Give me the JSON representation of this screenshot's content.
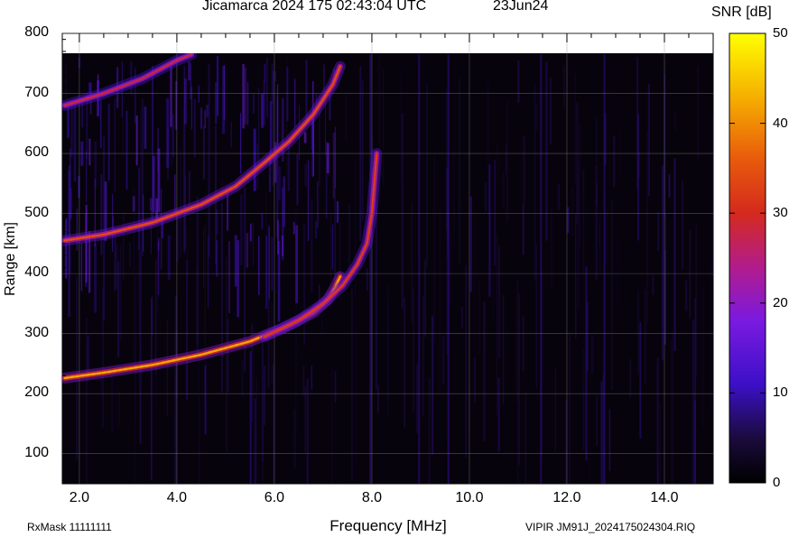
{
  "header": {
    "title": "Jicamarca 2024 175 02:43:04 UTC",
    "date": "23Jun24"
  },
  "footer": {
    "rxmask": "RxMask 11111111",
    "file": "VIPIR  JM91J_2024175024304.RIQ"
  },
  "chart_data": {
    "type": "heatmap",
    "title": "Jicamarca 2024 175 02:43:04 UTC",
    "xlabel": "Frequency [MHz]",
    "ylabel": "Range [km]",
    "xlim": [
      1.65,
      15.0
    ],
    "ylim": [
      50,
      800
    ],
    "data_top_range_km": 765,
    "x_ticks": [
      "2.0",
      "4.0",
      "6.0",
      "8.0",
      "10.0",
      "12.0",
      "14.0"
    ],
    "x_tick_values": [
      2,
      4,
      6,
      8,
      10,
      12,
      14
    ],
    "y_ticks": [
      "100",
      "200",
      "300",
      "400",
      "500",
      "600",
      "700",
      "800"
    ],
    "y_tick_values": [
      100,
      200,
      300,
      400,
      500,
      600,
      700,
      800
    ],
    "grid": true,
    "colorbar": {
      "label": "SNR [dB]",
      "range": [
        0,
        50
      ],
      "ticks": [
        "0",
        "10",
        "20",
        "30",
        "40",
        "50"
      ],
      "tick_values": [
        0,
        10,
        20,
        30,
        40,
        50
      ]
    },
    "traces": [
      {
        "name": "",
        "snr": 42,
        "points": [
          [
            1.7,
            226
          ],
          [
            2.5,
            235
          ],
          [
            3.5,
            248
          ],
          [
            4.5,
            265
          ],
          [
            5.5,
            287
          ],
          [
            6.2,
            310
          ],
          [
            6.8,
            335
          ],
          [
            7.1,
            357
          ],
          [
            7.25,
            378
          ],
          [
            7.35,
            395
          ]
        ]
      },
      {
        "name": "",
        "snr": 32,
        "points": [
          [
            5.8,
            295
          ],
          [
            6.5,
            322
          ],
          [
            7.0,
            350
          ],
          [
            7.4,
            380
          ],
          [
            7.7,
            415
          ],
          [
            7.9,
            450
          ],
          [
            8.0,
            500
          ],
          [
            8.05,
            550
          ],
          [
            8.1,
            600
          ]
        ]
      },
      {
        "name": "",
        "snr": 34,
        "points": [
          [
            1.7,
            455
          ],
          [
            2.5,
            465
          ],
          [
            3.5,
            485
          ],
          [
            4.5,
            515
          ],
          [
            5.2,
            545
          ],
          [
            5.8,
            585
          ],
          [
            6.3,
            620
          ],
          [
            6.8,
            665
          ],
          [
            7.2,
            715
          ],
          [
            7.35,
            745
          ]
        ]
      },
      {
        "name": "",
        "snr": 28,
        "points": [
          [
            1.7,
            680
          ],
          [
            2.5,
            700
          ],
          [
            3.3,
            725
          ],
          [
            4.0,
            755
          ],
          [
            4.3,
            765
          ]
        ]
      }
    ],
    "diffuse_region": {
      "x": [
        1.7,
        7.4
      ],
      "y": [
        450,
        765
      ],
      "snr": 12
    },
    "background_snr": 2
  }
}
